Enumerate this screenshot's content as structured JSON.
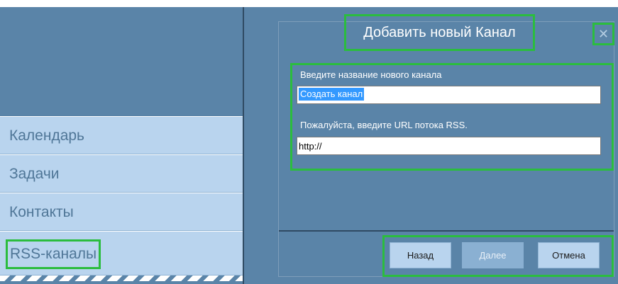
{
  "nav": {
    "items": [
      {
        "label": "Календарь"
      },
      {
        "label": "Задачи"
      },
      {
        "label": "Контакты"
      },
      {
        "label": "RSS-каналы"
      }
    ]
  },
  "dialog": {
    "title": "Добавить новый Канал",
    "close_icon": "✕",
    "name_label": "Введите название нового канала",
    "name_value": "Создать канал",
    "url_label": "Пожалуйста, введите URL потока RSS.",
    "url_value": "http://",
    "buttons": {
      "back": "Назад",
      "next": "Далее",
      "cancel": "Отмена"
    }
  },
  "colors": {
    "background": "#5a84a8",
    "nav_item": "#b9d4ee",
    "highlight": "#2bbd3e",
    "selection": "#3399ff"
  }
}
